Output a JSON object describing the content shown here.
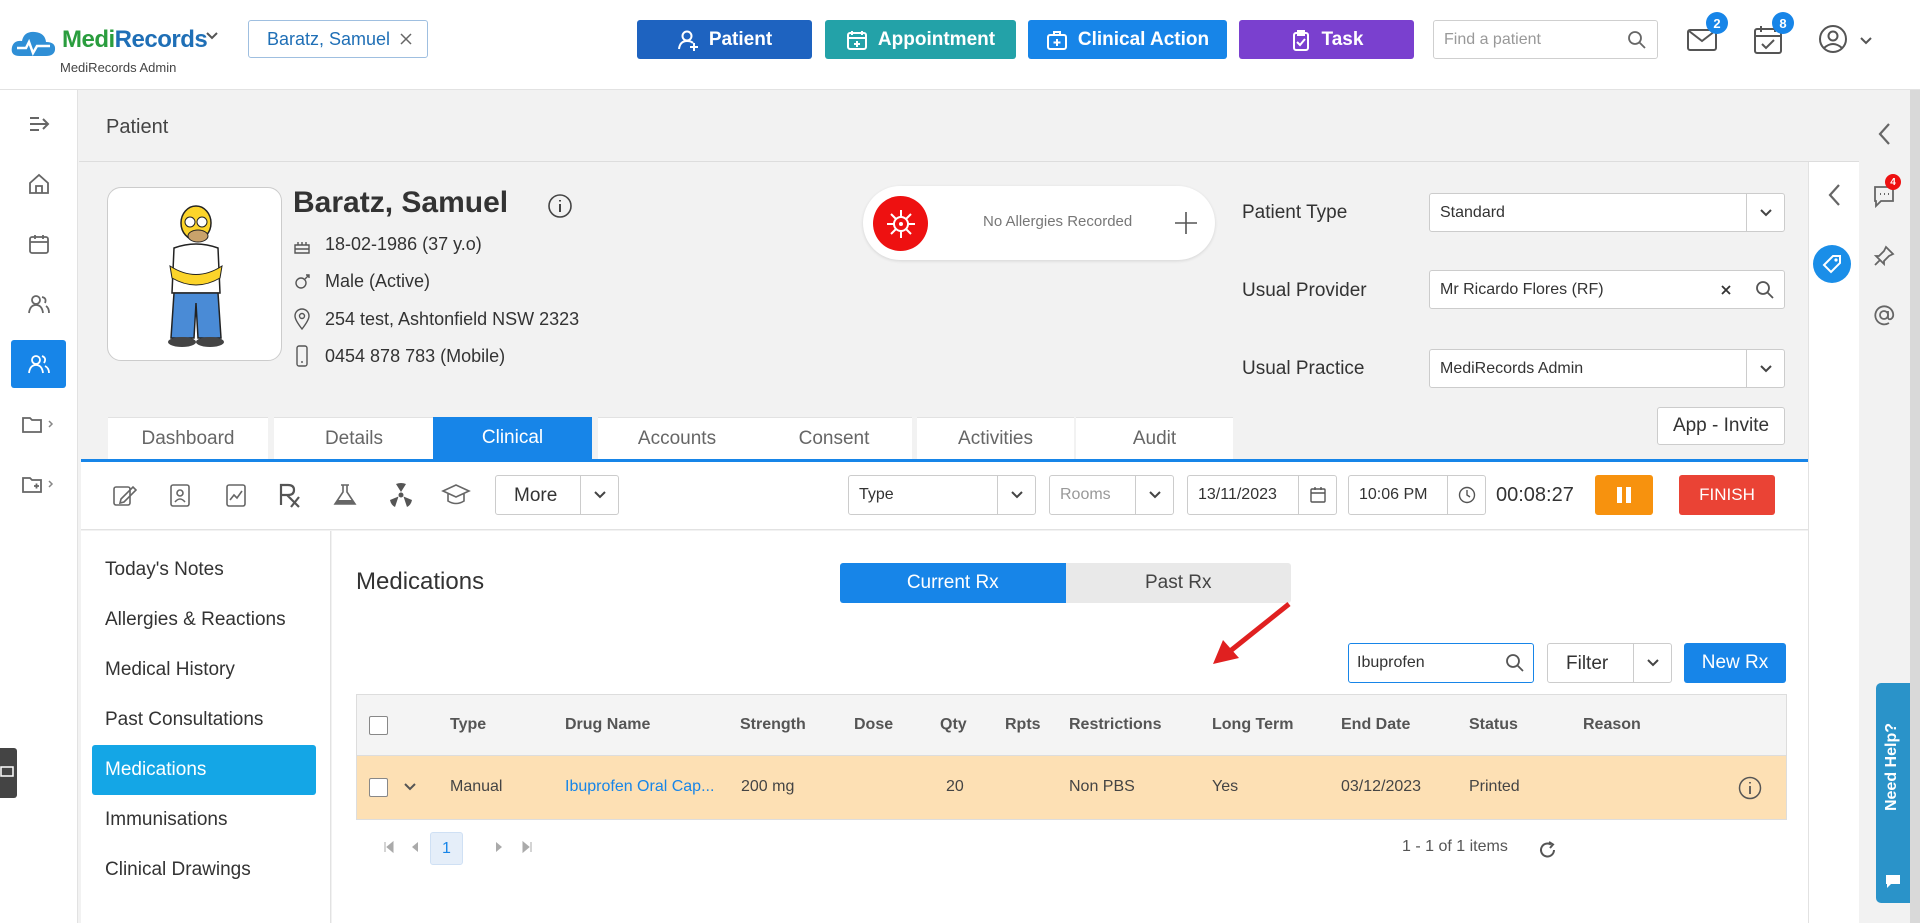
{
  "app": {
    "name_part1": "Medi",
    "name_part2": "Records",
    "practice": "MediRecords Admin"
  },
  "header": {
    "patient_chip": "Baratz, Samuel",
    "buttons": {
      "patient": "Patient",
      "appointment": "Appointment",
      "clinical_action": "Clinical Action",
      "task": "Task"
    },
    "search_placeholder": "Find a patient",
    "mail_badge": "2",
    "tasks_badge": "8",
    "colors": {
      "patient": "#1e63c0",
      "appointment": "#23a2a8",
      "clinical_action": "#1785e8",
      "task": "#7a40cf"
    }
  },
  "page": {
    "title": "Patient"
  },
  "patient": {
    "name": "Baratz, Samuel",
    "dob": "18-02-1986 (37 y.o)",
    "gender": "Male (Active)",
    "address": "254 test, Ashtonfield NSW 2323",
    "phone": "0454 878 783 (Mobile)",
    "allergies": "No Allergies Recorded"
  },
  "fields": {
    "patient_type_label": "Patient Type",
    "patient_type_value": "Standard",
    "usual_provider_label": "Usual Provider",
    "usual_provider_value": "Mr Ricardo Flores (RF)",
    "usual_practice_label": "Usual Practice",
    "usual_practice_value": "MediRecords Admin",
    "app_invite": "App - Invite"
  },
  "tabs": [
    "Dashboard",
    "Details",
    "Clinical",
    "Accounts",
    "Consent",
    "Activities",
    "Audit"
  ],
  "active_tab": "Clinical",
  "toolbar": {
    "more": "More",
    "type": "Type",
    "rooms": "Rooms",
    "date": "13/11/2023",
    "time": "10:06 PM",
    "timer": "00:08:27",
    "finish": "FINISH"
  },
  "leftnav": [
    "Today's Notes",
    "Allergies & Reactions",
    "Medical History",
    "Past Consultations",
    "Medications",
    "Immunisations",
    "Clinical Drawings"
  ],
  "active_leftnav": "Medications",
  "medications": {
    "title": "Medications",
    "tab_current": "Current Rx",
    "tab_past": "Past Rx",
    "search_value": "Ibuprofen",
    "filter": "Filter",
    "new_rx": "New Rx",
    "columns": [
      "Type",
      "Drug Name",
      "Strength",
      "Dose",
      "Qty",
      "Rpts",
      "Restrictions",
      "Long Term",
      "End Date",
      "Status",
      "Reason"
    ],
    "rows": [
      {
        "type": "Manual",
        "drug_name": "Ibuprofen Oral Cap...",
        "strength": "200 mg",
        "dose": "",
        "qty": "20",
        "rpts": "",
        "restrictions": "Non PBS",
        "long_term": "Yes",
        "end_date": "03/12/2023",
        "status": "Printed",
        "reason": ""
      }
    ],
    "page": "1",
    "pager_info": "1 - 1 of 1 items"
  },
  "right_rail": {
    "chat_badge": "4",
    "need_help": "Need Help?"
  }
}
